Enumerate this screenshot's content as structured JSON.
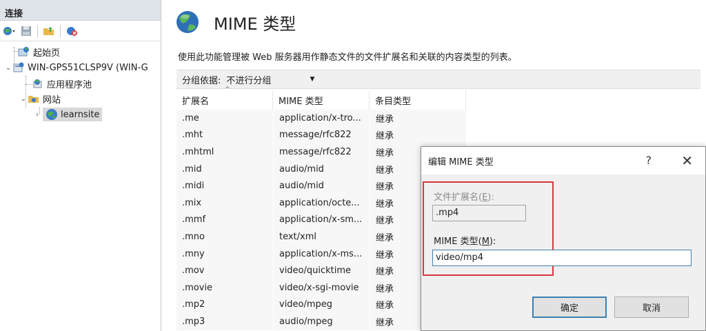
{
  "left_pane": {
    "title": "连接",
    "tree": [
      {
        "label": "起始页"
      },
      {
        "label": "WIN-GPS51CLSP9V (WIN-G"
      },
      {
        "label": "应用程序池"
      },
      {
        "label": "网站"
      },
      {
        "label": "learnsite"
      }
    ]
  },
  "main": {
    "title": "MIME 类型",
    "description": "使用此功能管理被 Web 服务器用作静态文件的文件扩展名和关联的内容类型的列表。",
    "group_by_label": "分组依据:",
    "group_by_value": "不进行分组",
    "columns": [
      "扩展名",
      "MIME 类型",
      "条目类型"
    ],
    "rows": [
      {
        "ext": ".me",
        "mime": "application/x-tro...",
        "type": "继承"
      },
      {
        "ext": ".mht",
        "mime": "message/rfc822",
        "type": "继承"
      },
      {
        "ext": ".mhtml",
        "mime": "message/rfc822",
        "type": "继承"
      },
      {
        "ext": ".mid",
        "mime": "audio/mid",
        "type": "继承"
      },
      {
        "ext": ".midi",
        "mime": "audio/mid",
        "type": "继承"
      },
      {
        "ext": ".mix",
        "mime": "application/octe...",
        "type": "继承"
      },
      {
        "ext": ".mmf",
        "mime": "application/x-sm...",
        "type": "继承"
      },
      {
        "ext": ".mno",
        "mime": "text/xml",
        "type": "继承"
      },
      {
        "ext": ".mny",
        "mime": "application/x-ms...",
        "type": "继承"
      },
      {
        "ext": ".mov",
        "mime": "video/quicktime",
        "type": "继承"
      },
      {
        "ext": ".movie",
        "mime": "video/x-sgi-movie",
        "type": "继承"
      },
      {
        "ext": ".mp2",
        "mime": "video/mpeg",
        "type": "继承"
      },
      {
        "ext": ".mp3",
        "mime": "audio/mpeg",
        "type": "继承"
      }
    ]
  },
  "dialog": {
    "title": "编辑 MIME 类型",
    "help": "?",
    "close": "✕",
    "ext_label": "文件扩展名(",
    "ext_label_key": "E",
    "ext_label_end": "):",
    "ext_value": ".mp4",
    "mime_label": "MIME 类型(",
    "mime_label_key": "M",
    "mime_label_end": "):",
    "mime_value": "video/mp4",
    "ok": "确定",
    "cancel": "取消"
  },
  "colors": {
    "highlight_border": "#d9363e",
    "focus_blue": "#3c7fb1"
  }
}
